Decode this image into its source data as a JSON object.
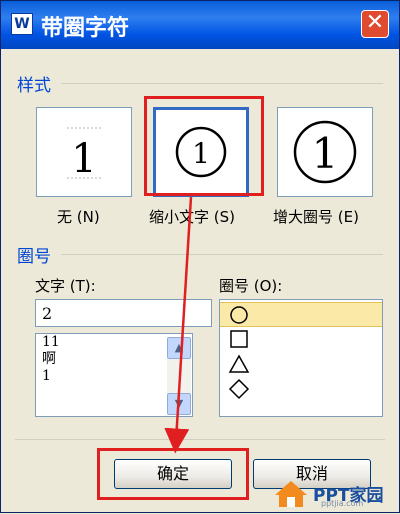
{
  "dialog": {
    "title": "带圈字符",
    "app_icon": "W",
    "close_glyph": "✕"
  },
  "style_group": {
    "label": "样式",
    "options": [
      {
        "caption": "无 (N)",
        "preview": "1",
        "selected": false
      },
      {
        "caption": "缩小文字 (S)",
        "preview": "①",
        "selected": true
      },
      {
        "caption": "增大圈号 (E)",
        "preview": "①",
        "selected": false
      }
    ]
  },
  "circle_group": {
    "label": "圈号",
    "text_label": "文字 (T):",
    "text_value": "2",
    "text_list": [
      "11",
      "啊",
      "1"
    ],
    "shape_label": "圈号 (O):",
    "shapes": [
      "○",
      "□",
      "△",
      "◇"
    ],
    "selected_shape": 0
  },
  "buttons": {
    "ok": "确定",
    "cancel": "取消"
  },
  "watermark": {
    "text": "PPT家园",
    "sub": "pptjia.com"
  },
  "colors": {
    "annotation_red": "#e02020",
    "titlebar_blue": "#0054e3",
    "group_label_blue": "#0046d5"
  }
}
